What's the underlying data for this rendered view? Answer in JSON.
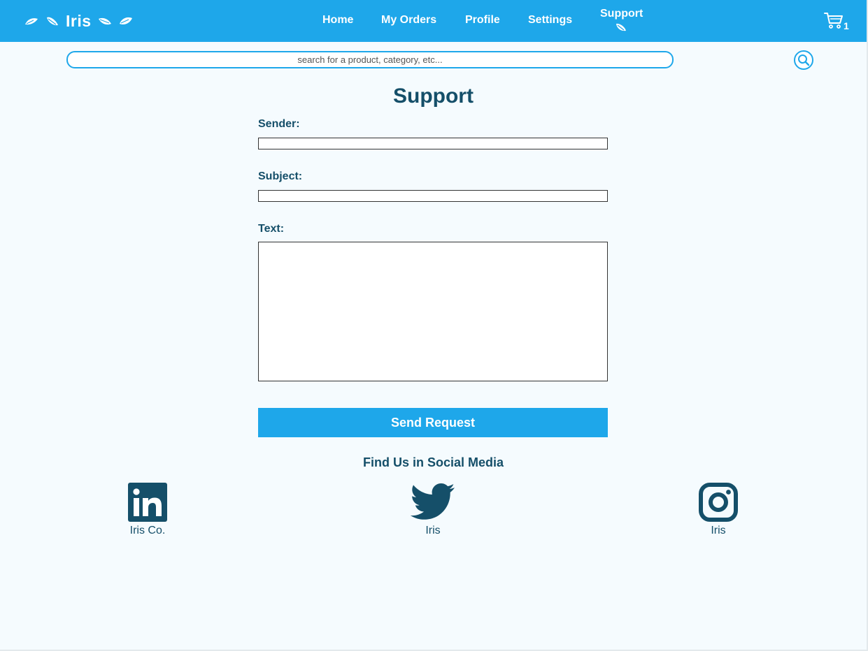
{
  "brand": {
    "name": "Iris"
  },
  "nav": {
    "items": [
      "Home",
      "My Orders",
      "Profile",
      "Settings",
      "Support"
    ]
  },
  "cart": {
    "count": "1",
    "icon": "cart-icon"
  },
  "search": {
    "placeholder": "search for a product, category, etc...",
    "icon": "search-icon"
  },
  "form": {
    "title": "Support",
    "sender_label": "Sender:",
    "subject_label": "Subject:",
    "text_label": "Text:",
    "sender_value": "",
    "subject_value": "",
    "text_value": "",
    "submit_label": "Send Request"
  },
  "social": {
    "title": "Find Us in Social Media",
    "links": [
      {
        "label": "Iris Co.",
        "icon": "linkedin-icon"
      },
      {
        "label": "Iris",
        "icon": "twitter-icon"
      },
      {
        "label": "Iris",
        "icon": "instagram-icon"
      }
    ]
  },
  "colors": {
    "accent": "#1ea7ea",
    "text": "#154f69",
    "background": "#f5fbfe"
  }
}
